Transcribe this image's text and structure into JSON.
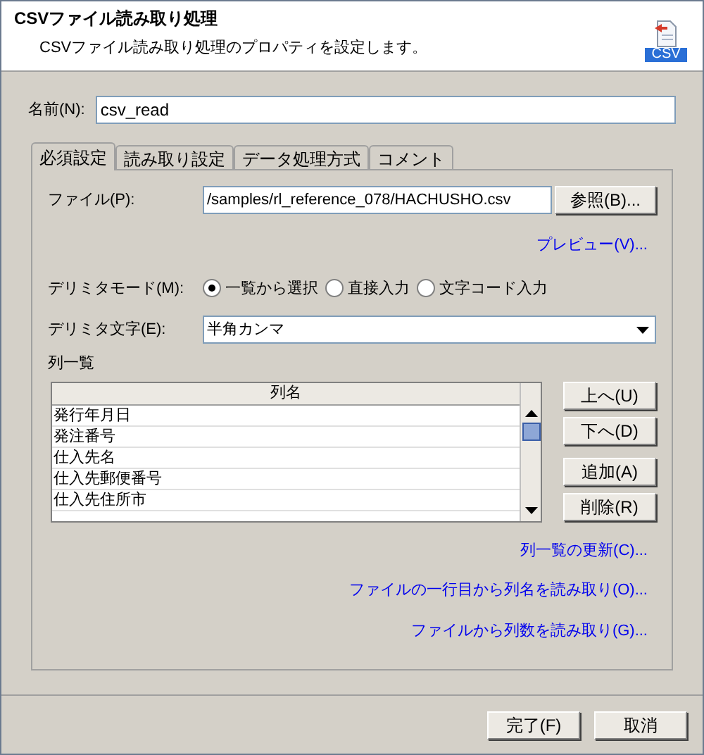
{
  "header": {
    "title": "CSVファイル読み取り処理",
    "subtitle": "CSVファイル読み取り処理のプロパティを設定します。",
    "badge": "CSV"
  },
  "name_field": {
    "label": "名前(N):",
    "value": "csv_read"
  },
  "tabs": [
    {
      "label": "必須設定",
      "selected": true
    },
    {
      "label": "読み取り設定",
      "selected": false
    },
    {
      "label": "データ処理方式",
      "selected": false
    },
    {
      "label": "コメント",
      "selected": false
    }
  ],
  "file": {
    "label": "ファイル(P):",
    "value": "/samples/rl_reference_078/HACHUSHO.csv",
    "browse": "参照(B)..."
  },
  "preview_link": "プレビュー(V)...",
  "delimiter_mode": {
    "label": "デリミタモード(M):",
    "options": [
      {
        "label": "一覧から選択",
        "selected": true
      },
      {
        "label": "直接入力",
        "selected": false
      },
      {
        "label": "文字コード入力",
        "selected": false
      }
    ]
  },
  "delimiter_char": {
    "label": "デリミタ文字(E):",
    "value": "半角カンマ"
  },
  "column_list": {
    "label": "列一覧",
    "header": "列名",
    "rows": [
      "発行年月日",
      "発注番号",
      "仕入先名",
      "仕入先郵便番号",
      "仕入先住所市"
    ],
    "buttons": [
      "上へ(U)",
      "下へ(D)",
      "追加(A)",
      "削除(R)"
    ]
  },
  "links": [
    "列一覧の更新(C)...",
    "ファイルの一行目から列名を読み取り(O)...",
    "ファイルから列数を読み取り(G)..."
  ],
  "footer_buttons": [
    "完了(F)",
    "取消"
  ]
}
